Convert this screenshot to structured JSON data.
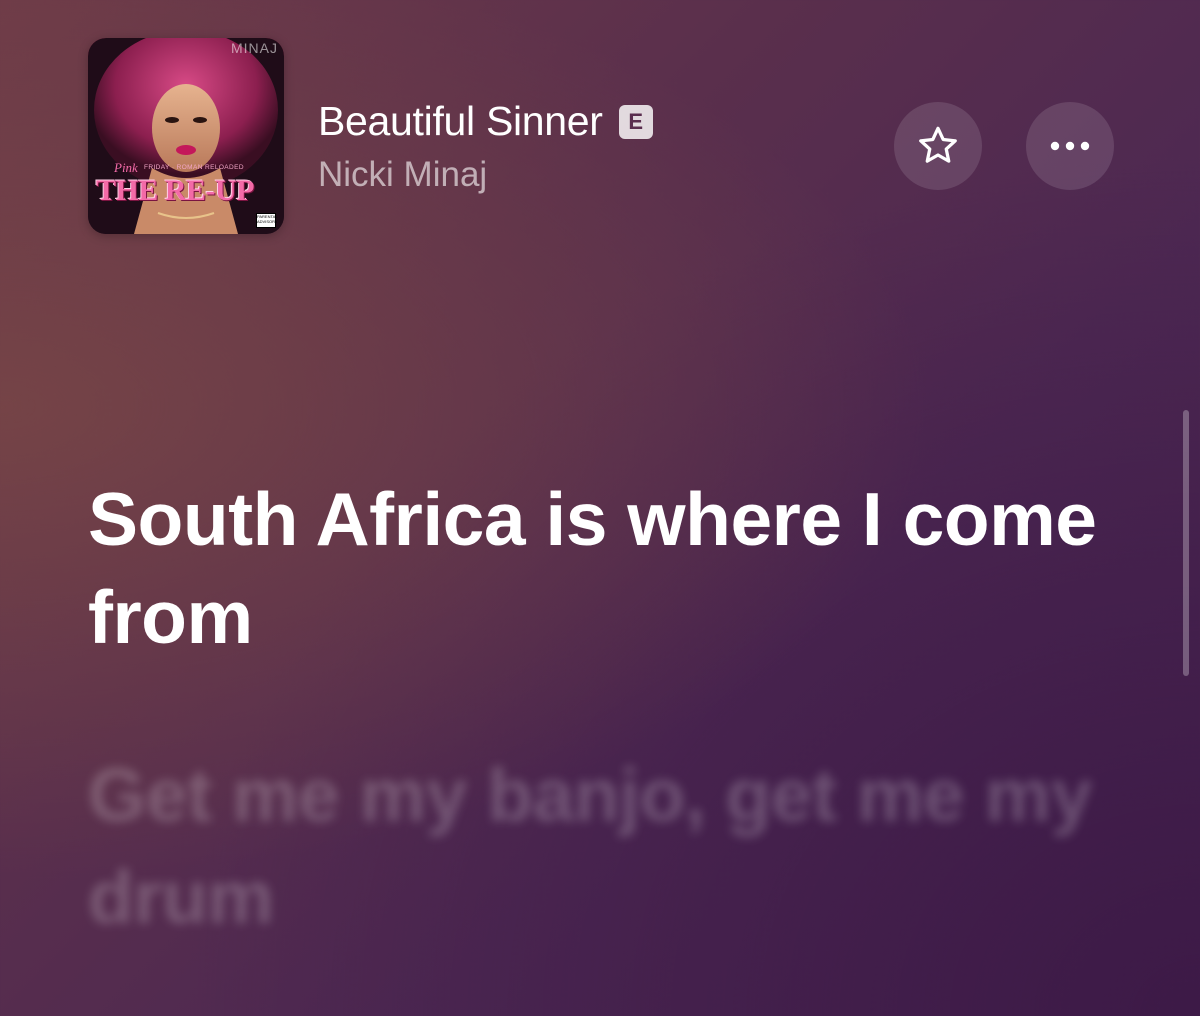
{
  "now_playing": {
    "artwork": {
      "top_text": "MINAJ",
      "pink_text": "Pink",
      "subtitle_text": "FRIDAY · ROMAN RELOADED",
      "album_title": "THE RE-UP",
      "advisory_text": "PARENTAL ADVISORY"
    },
    "song_title": "Beautiful Sinner",
    "explicit_badge": "E",
    "artist": "Nicki Minaj",
    "favorite_icon": "star-icon",
    "more_icon": "ellipsis-icon"
  },
  "lyrics": {
    "current_line": "South Africa is where I come from",
    "next_line": "Get me my banjo, get me my drum"
  },
  "colors": {
    "background_start": "#6e3b48",
    "background_end": "#45224f",
    "text_primary": "#ffffff",
    "album_pink": "#f36aa7"
  }
}
